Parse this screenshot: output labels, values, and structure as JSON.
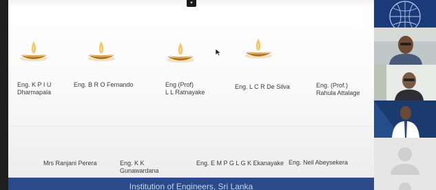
{
  "slide": {
    "footer": "Institution of Engineers, Sri Lanka",
    "row1": [
      {
        "line1": "Eng. K P I U",
        "line2": "Dharmapala"
      },
      {
        "line1": "Eng. B R O Fernando",
        "line2": ""
      },
      {
        "line1": "Eng (Prof)",
        "line2": "L L Ratnayake"
      },
      {
        "line1": "Eng. L C R De Silva",
        "line2": ""
      },
      {
        "line1": "Eng. (Prof.)",
        "line2": "Rahula Attalage"
      }
    ],
    "row2": [
      {
        "line1": "Mrs Ranjani Perera",
        "line2": ""
      },
      {
        "line1": "Eng. K K",
        "line2": "Gunawardana"
      },
      {
        "line1": "Eng. E M P G L G K Ekanayake",
        "line2": ""
      },
      {
        "line1": "Eng. Neil Abeysekera",
        "line2": ""
      }
    ]
  },
  "icons": {
    "lamp": "oil-lamp-icon",
    "cursor": "mouse-cursor-icon",
    "user_placeholder": "user-avatar-icon"
  },
  "colors": {
    "footer_bar": "#2b4a8a",
    "flame": "#f2a733",
    "lamp_bowl": "#c9871d"
  }
}
